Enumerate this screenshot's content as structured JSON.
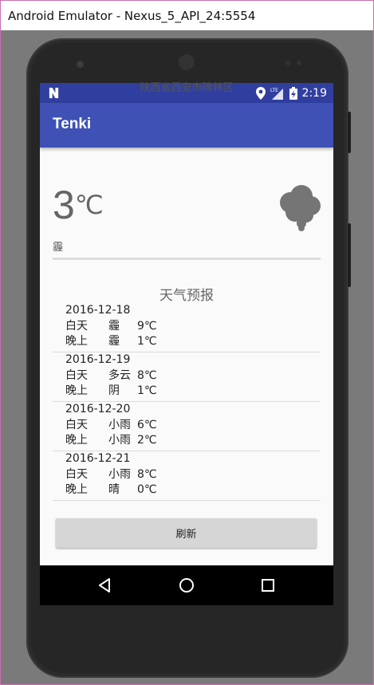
{
  "window": {
    "title": "Android Emulator - Nexus_5_API_24:5554"
  },
  "statusbar": {
    "time": "2:19",
    "network_label": "LTE"
  },
  "appbar": {
    "title": "Tenki"
  },
  "weather": {
    "location": "陕西省西安市碑林区",
    "temperature": "3",
    "unit": "℃",
    "description": "霾",
    "icon": "cloud-fog-icon"
  },
  "forecast": {
    "title": "天气预报",
    "items": [
      {
        "date": "2016-12-18",
        "day_label": "白天",
        "day_weather": "霾",
        "day_temp": "9℃",
        "night_label": "晚上",
        "night_weather": "霾",
        "night_temp": "1℃"
      },
      {
        "date": "2016-12-19",
        "day_label": "白天",
        "day_weather": "多云",
        "day_temp": "8℃",
        "night_label": "晚上",
        "night_weather": "阴",
        "night_temp": "1℃"
      },
      {
        "date": "2016-12-20",
        "day_label": "白天",
        "day_weather": "小雨",
        "day_temp": "6℃",
        "night_label": "晚上",
        "night_weather": "小雨",
        "night_temp": "2℃"
      },
      {
        "date": "2016-12-21",
        "day_label": "白天",
        "day_weather": "小雨",
        "day_temp": "8℃",
        "night_label": "晚上",
        "night_weather": "晴",
        "night_temp": "0℃"
      }
    ]
  },
  "actions": {
    "refresh_label": "刷新"
  },
  "colors": {
    "status_bar": "#303f9f",
    "app_bar": "#3f51b5",
    "screen_bg": "#fafafa",
    "button_bg": "#d6d6d6"
  },
  "nav": {
    "back_icon": "back-triangle-icon",
    "home_icon": "home-circle-icon",
    "recents_icon": "recents-square-icon"
  }
}
